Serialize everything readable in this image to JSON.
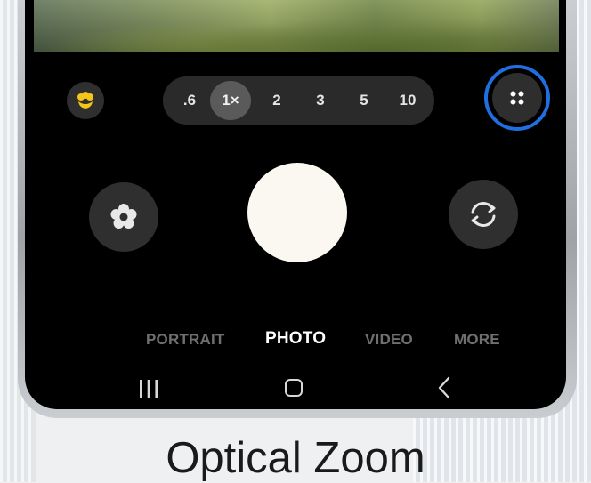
{
  "camera": {
    "zoom_levels": [
      ".6",
      "1×",
      "2",
      "3",
      "5",
      "10"
    ],
    "active_zoom": "1×",
    "modes": [
      {
        "label": "PORTRAIT",
        "active": false
      },
      {
        "label": "PHOTO",
        "active": true
      },
      {
        "label": "VIDEO",
        "active": false
      },
      {
        "label": "MORE",
        "active": false
      }
    ],
    "icons": {
      "macro": "flower-icon",
      "settings": "grid-dots-icon",
      "effects": "filter-flower-icon",
      "flip": "camera-flip-icon"
    },
    "colors": {
      "macro_icon": "#f5c518",
      "highlight_ring": "#1f6fe0",
      "shutter": "#fbf8f2"
    }
  },
  "nav_bar": {
    "icons": [
      "recents-icon",
      "home-icon",
      "back-icon"
    ]
  },
  "caption": "Optical Zoom"
}
